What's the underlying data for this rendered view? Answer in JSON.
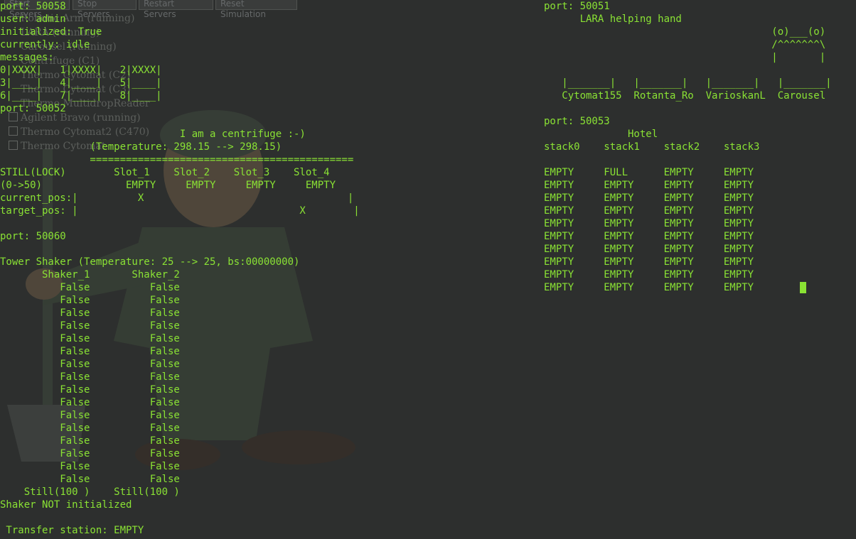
{
  "background_window": {
    "buttons": [
      "Start Servers",
      "Stop Servers",
      "Restart Servers",
      "Reset Simulation"
    ],
    "items": [
      {
        "label": "Robotic Arm (running)",
        "checkbox": false
      },
      {
        "label": "LARA (running)",
        "checkbox": false
      },
      {
        "label": "Carousel (running)",
        "checkbox": false
      },
      {
        "label": "Centrifuge (C1)",
        "checkbox": false
      },
      {
        "label": "Thermo Cytomat (C2)",
        "checkbox": false
      },
      {
        "label": "Thermo Cytomat (C3)",
        "checkbox": false
      },
      {
        "label": "Thermo MultidropReader",
        "checkbox": false
      },
      {
        "label": "Agilent Bravo (running)",
        "checkbox": true
      },
      {
        "label": "Thermo Cytomat2 (C470)",
        "checkbox": true
      },
      {
        "label": "Thermo Cytomat",
        "checkbox": true
      }
    ]
  },
  "left_terminal": {
    "lines": [
      "port: 50058",
      "user: admin",
      "initialized: True",
      "currently: idle",
      "messages:",
      "0|XXXX|   1|XXXX|   2|XXXX|",
      "3|____|   4|____|   5|____|",
      "6|____|   7|____|   8|____|",
      "port: 50052",
      "",
      "                              I am a centrifuge :-)",
      "               (Temperature: 298.15 --> 298.15)",
      "               ============================================",
      "STILL(LOCK)        Slot_1    Slot_2    Slot_3    Slot_4",
      "(0->50)              EMPTY     EMPTY     EMPTY     EMPTY",
      "current_pos:|          X                                  |",
      "target_pos: |                                     X        |",
      "",
      "port: 50060",
      "",
      "Tower Shaker (Temperature: 25 --> 25, bs:00000000)",
      "       Shaker_1       Shaker_2",
      "          False          False",
      "          False          False",
      "          False          False",
      "          False          False",
      "          False          False",
      "          False          False",
      "          False          False",
      "          False          False",
      "          False          False",
      "          False          False",
      "          False          False",
      "          False          False",
      "          False          False",
      "          False          False",
      "          False          False",
      "          False          False",
      "    Still(100 )    Still(100 )",
      "Shaker NOT initialized",
      "",
      " Transfer station: EMPTY"
    ]
  },
  "right_terminal": {
    "lines": [
      "port: 50051",
      "      LARA helping hand",
      "                                      (o)___(o)",
      "                                      /^^^^^^^\\",
      "                                      |       |",
      "",
      "   |_______|   |_______|   |_______|   |_______|",
      "   Cytomat155  Rotanta_Ro  VarioskanL  Carousel",
      "",
      "port: 50053",
      "              Hotel",
      "stack0    stack1    stack2    stack3",
      "",
      "EMPTY     FULL      EMPTY     EMPTY",
      "EMPTY     EMPTY     EMPTY     EMPTY",
      "EMPTY     EMPTY     EMPTY     EMPTY",
      "EMPTY     EMPTY     EMPTY     EMPTY",
      "EMPTY     EMPTY     EMPTY     EMPTY",
      "EMPTY     EMPTY     EMPTY     EMPTY",
      "EMPTY     EMPTY     EMPTY     EMPTY",
      "EMPTY     EMPTY     EMPTY     EMPTY",
      "EMPTY     EMPTY     EMPTY     EMPTY",
      "EMPTY     EMPTY     EMPTY     EMPTY"
    ]
  },
  "colors": {
    "terminal_bg": "#2d2f2e",
    "terminal_fg": "#8ae234",
    "cursor": "#8ae234"
  }
}
